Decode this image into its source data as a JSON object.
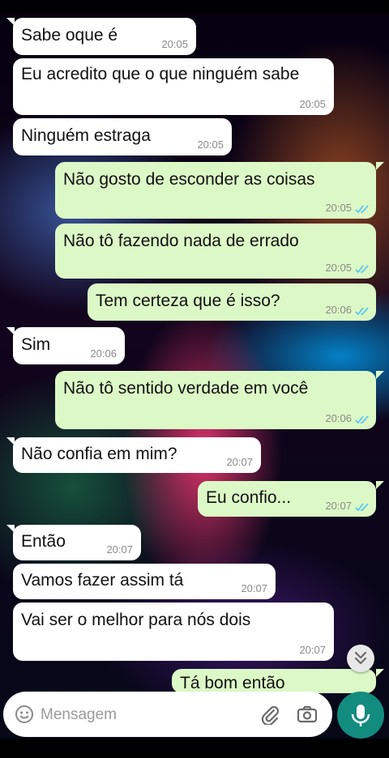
{
  "messages": [
    {
      "dir": "in",
      "text": "Sabe oque é",
      "time": "20:05"
    },
    {
      "dir": "in",
      "text": "Eu acredito que o que ninguém sabe",
      "time": "20:05"
    },
    {
      "dir": "in",
      "text": "Ninguém estraga",
      "time": "20:05"
    },
    {
      "dir": "out",
      "text": "Não gosto de esconder as coisas",
      "time": "20:05"
    },
    {
      "dir": "out",
      "text": "Não tô fazendo nada de errado",
      "time": "20:05"
    },
    {
      "dir": "out",
      "text": "Tem certeza que é isso?",
      "time": "20:06"
    },
    {
      "dir": "in",
      "text": "Sim",
      "time": "20:06"
    },
    {
      "dir": "out",
      "text": "Não tô sentido verdade em você",
      "time": "20:06"
    },
    {
      "dir": "in",
      "text": "Não confia em mim?",
      "time": "20:07"
    },
    {
      "dir": "out",
      "text": "Eu confio...",
      "time": "20:07"
    },
    {
      "dir": "in",
      "text": "Então",
      "time": "20:07"
    },
    {
      "dir": "in",
      "text": "Vamos fazer assim tá",
      "time": "20:07"
    },
    {
      "dir": "in",
      "text": "Vai ser o melhor para nós dois",
      "time": "20:07"
    },
    {
      "dir": "out",
      "text": "Tá bom então",
      "time": ""
    }
  ],
  "composer": {
    "placeholder": "Mensagem",
    "emoji_icon": "emoji-icon",
    "attach_icon": "paperclip-icon",
    "camera_icon": "camera-icon",
    "mic_icon": "microphone-icon"
  },
  "scroll_down_icon": "double-chevron-down-icon",
  "colors": {
    "incoming": "#ffffff",
    "outgoing": "#dcf8c6",
    "accent": "#128c7e",
    "read_ticks": "#4fc3f7"
  }
}
